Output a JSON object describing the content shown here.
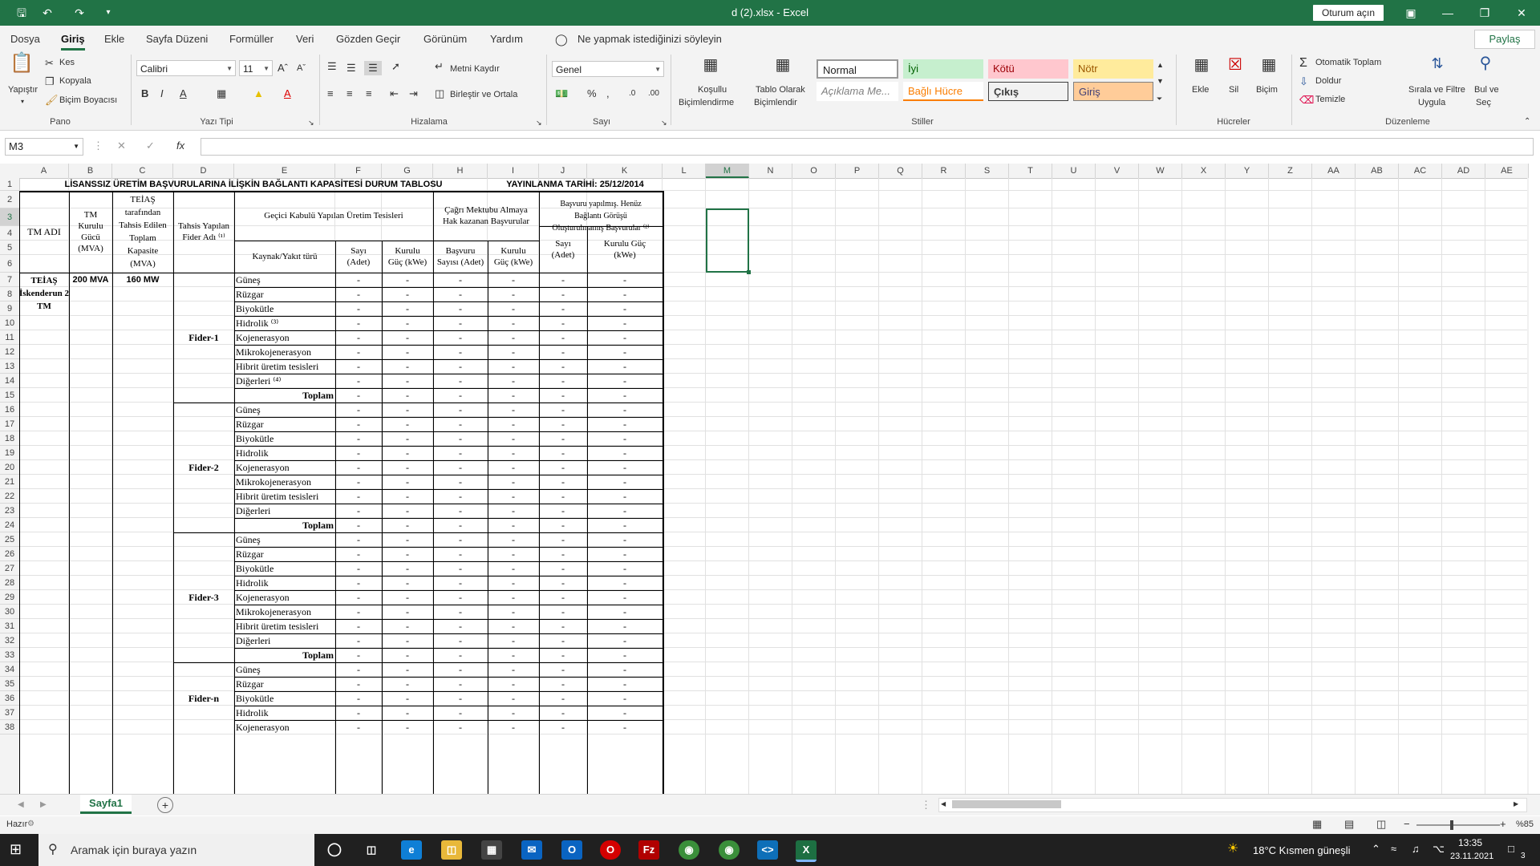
{
  "titlebar": {
    "title": "d (2).xlsx  -  Excel",
    "signin": "Oturum açın"
  },
  "menu": [
    "Dosya",
    "Giriş",
    "Ekle",
    "Sayfa Düzeni",
    "Formüller",
    "Veri",
    "Gözden Geçir",
    "Görünüm",
    "Yardım"
  ],
  "tell_me": "Ne yapmak istediğinizi söyleyin",
  "share": "Paylaş",
  "ribbon": {
    "paste": "Yapıştır",
    "cut": "Kes",
    "copy": "Kopyala",
    "format_painter": "Biçim Boyacısı",
    "font_name": "Calibri",
    "font_size": "11",
    "wrap_text": "Metni Kaydır",
    "merge_center": "Birleştir ve Ortala",
    "number_format": "Genel",
    "cond_format_1": "Koşullu",
    "cond_format_2": "Biçimlendirme",
    "format_table_1": "Tablo Olarak",
    "format_table_2": "Biçimlendir",
    "styles": {
      "normal": "Normal",
      "good": "İyi",
      "bad": "Kötü",
      "neutral": "Nötr",
      "explanatory": "Açıklama Me...",
      "linked": "Bağlı Hücre",
      "output": "Çıkış",
      "input": "Giriş"
    },
    "insert": "Ekle",
    "delete": "Sil",
    "format": "Biçim",
    "autosum": "Otomatik Toplam",
    "fill": "Doldur",
    "clear": "Temizle",
    "sort_1": "Sırala ve Filtre",
    "sort_2": "Uygula",
    "find_1": "Bul ve",
    "find_2": "Seç",
    "groups": {
      "clipboard": "Pano",
      "font": "Yazı Tipi",
      "alignment": "Hizalama",
      "number": "Sayı",
      "styles": "Stiller",
      "cells": "Hücreler",
      "editing": "Düzenleme"
    }
  },
  "formula": {
    "namebox": "M3",
    "fx": "fx",
    "content": ""
  },
  "columns": [
    "A",
    "B",
    "C",
    "D",
    "E",
    "F",
    "G",
    "H",
    "I",
    "J",
    "K",
    "L",
    "M",
    "N",
    "O",
    "P",
    "Q",
    "R",
    "S",
    "T",
    "U",
    "V",
    "W",
    "X",
    "Y",
    "Z",
    "AA",
    "AB",
    "AC",
    "AD",
    "AE"
  ],
  "rows": [
    "1",
    "2",
    "3",
    "4",
    "5",
    "6",
    "7",
    "8",
    "9",
    "10",
    "11",
    "12",
    "13",
    "14",
    "15",
    "16",
    "17",
    "18",
    "19",
    "20",
    "21",
    "22",
    "23",
    "24",
    "25",
    "26",
    "27",
    "28",
    "29",
    "30",
    "31",
    "32",
    "33",
    "34",
    "35",
    "36",
    "37",
    "38"
  ],
  "sheet": {
    "title": "LİSANSSIZ ÜRETİM BAŞVURULARINA İLİŞKİN BAĞLANTI KAPASİTESİ DURUM TABLOSU",
    "date": "YAYINLANMA TARİHİ: 25/12/2014",
    "h_tm": "TM ADI",
    "h_b": [
      "TM",
      "Kurulu",
      "Gücü",
      "(MVA)"
    ],
    "h_c": [
      "TEİAŞ",
      "tarafından",
      "Tahsis Edilen",
      "Toplam",
      "Kapasite",
      "(MVA)"
    ],
    "h_d": [
      "Tahsis Yapılan",
      "Fider Adı ⁽¹⁾"
    ],
    "h_e": "Geçici Kabulü Yapılan Üretim Tesisleri",
    "h_h": [
      "Çağrı Mektubu Almaya",
      "Hak kazanan Başvurular"
    ],
    "h_j": [
      "Başvuru yapılmış. Henüz",
      "Bağlantı Görüşü",
      "Oluşturulmamış Başvurular ⁽²⁾"
    ],
    "sub_e": "Kaynak/Yakıt türü",
    "sub_f": [
      "Sayı",
      "(Adet)"
    ],
    "sub_g": [
      "Kurulu",
      "Güç (kWe)"
    ],
    "sub_h": [
      "Başvuru",
      "Sayısı (Adet)"
    ],
    "sub_i": [
      "Kurulu",
      "Güç (kWe)"
    ],
    "sub_j": [
      "Sayı",
      "(Adet)"
    ],
    "sub_k": [
      "Kurulu Güç",
      "(kWe)"
    ],
    "a7": [
      "TEİAŞ",
      "İskenderun 2",
      "TM"
    ],
    "b7": "200 MVA",
    "c7": "160 MW",
    "fiders": [
      "Fider-1",
      "Fider-2",
      "Fider-3",
      "Fider-n"
    ],
    "total": "Toplam",
    "dash": "-",
    "types1": [
      "Güneş",
      "Rüzgar",
      "Biyokütle",
      "Hidrolik ⁽³⁾",
      "Kojenerasyon",
      "Mikrokojenerasyon",
      "Hibrit üretim tesisleri",
      "Diğerleri ⁽⁴⁾"
    ],
    "types2": [
      "Güneş",
      "Rüzgar",
      "Biyokütle",
      "Hidrolik",
      "Kojenerasyon",
      "Mikrokojenerasyon",
      "Hibrit üretim tesisleri",
      "Diğerleri"
    ],
    "types4": [
      "Güneş",
      "Rüzgar",
      "Biyokütle",
      "Hidrolik",
      "Kojenerasyon"
    ]
  },
  "tabs": {
    "sheet1": "Sayfa1"
  },
  "status": {
    "ready": "Hazır",
    "zoom": "%85"
  },
  "taskbar": {
    "search": "Aramak için buraya yazın",
    "weather": "18°C  Kısmen güneşli",
    "time": "13:35",
    "date": "23.11.2021",
    "notif": "3"
  }
}
